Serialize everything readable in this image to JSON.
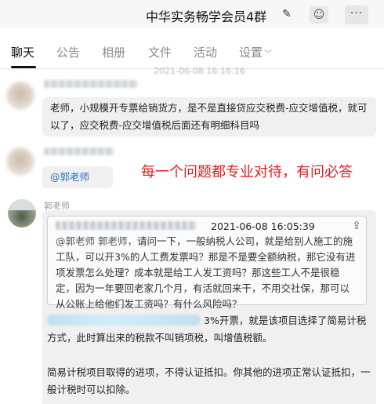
{
  "window": {
    "title": "中华实务畅学会员4群",
    "edit_icon": "✎",
    "emoji_icon": "☺",
    "more_icon": "···"
  },
  "tabs": [
    {
      "label": "聊天",
      "active": true
    },
    {
      "label": "公告"
    },
    {
      "label": "相册"
    },
    {
      "label": "文件"
    },
    {
      "label": "活动"
    },
    {
      "label": "设置"
    }
  ],
  "chat": {
    "timestamp": "2021-06-08 16:16:16",
    "messages": [
      {
        "text": "老师，小规模开专票给销货方，是不是直接贷应交税费-应交增值税，就可以了，应交税费-应交增值税后面还有明细科目吗"
      },
      {
        "mention": "@郭老师"
      },
      {
        "sender": "郭老师",
        "quote": {
          "time": "2021-06-08 16:05:39",
          "mention": "@郭老师 郭老师，",
          "text": "请问一下，一般纳税人公司，就是给别人施工的施工队，可以开3%的人工费发票吗？那是不是要全额纳税，那它没有进项发票怎么处理？成本就是给工人发工资吗？那这些工人不是很稳定，因为一年要回老家几个月，有活就回来干，不用交社保，那可以从公账上给他们发工资吗？有什么风险吗？"
        },
        "answer_1": "3%开票，就是该项目选择了简易计税方式，此时算出来的税款不叫销项税，叫增值税额。",
        "answer_2": "简易计税项目取得的进项，不得认证抵扣。你其他的进项正常认证抵扣，一般计税时可以扣除。"
      }
    ],
    "annotation": "每一个问题都专业对待，有问必答"
  },
  "colors": {
    "annotation_red": "#e11d1d",
    "mention_blue": "#2b6fc6",
    "bubble_gray": "#f0f0f0"
  }
}
